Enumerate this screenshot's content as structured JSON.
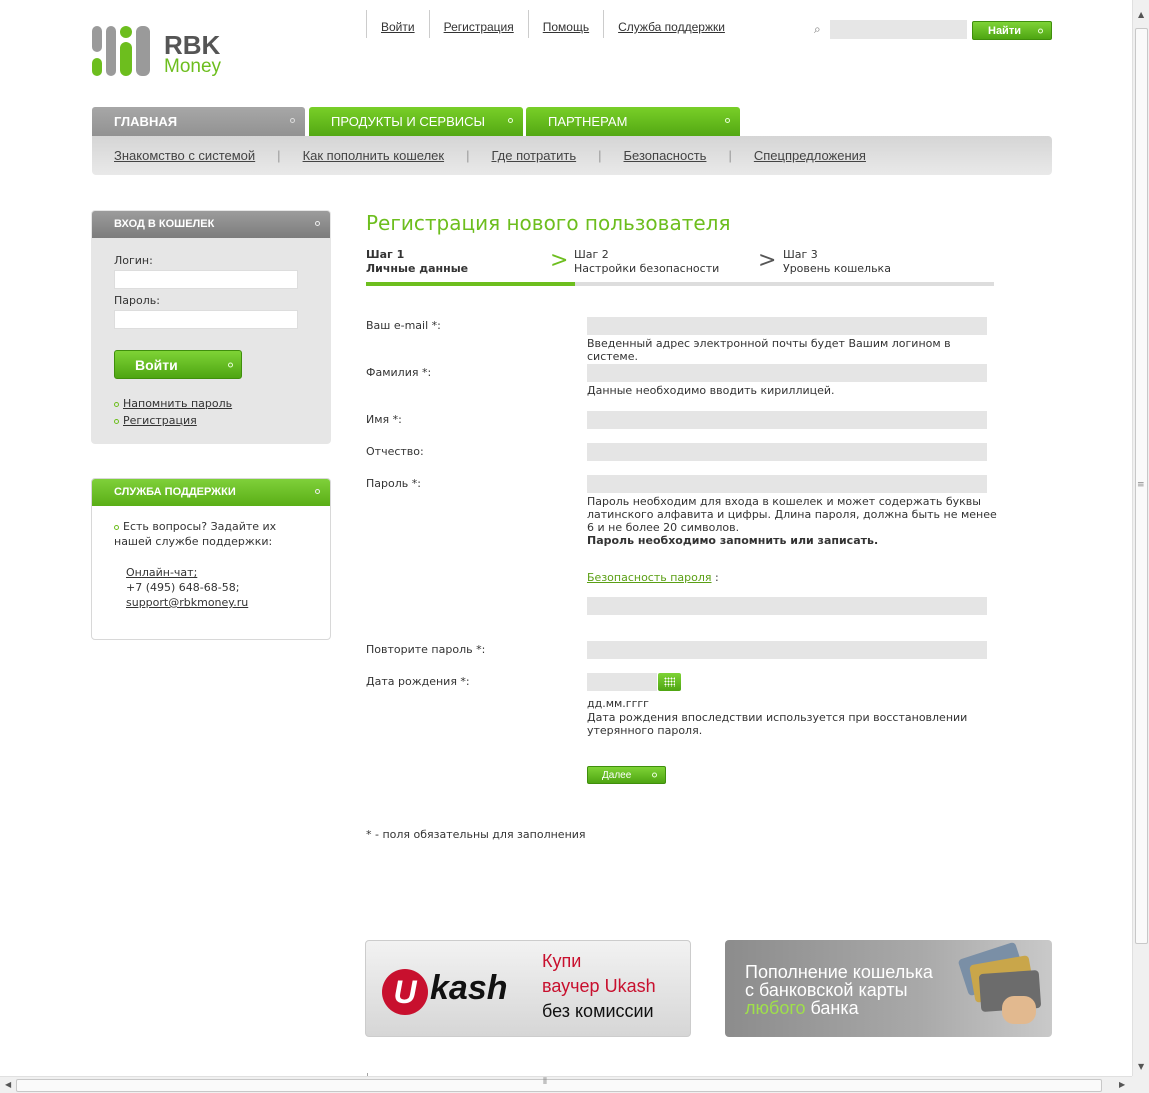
{
  "logo": {
    "line1": "RBK",
    "line2": "Money"
  },
  "top_links": [
    "Войти",
    "Регистрация",
    "Помощь",
    "Служба поддержки"
  ],
  "search": {
    "placeholder": "",
    "button": "Найти"
  },
  "main_tabs": [
    {
      "label": "ГЛАВНАЯ",
      "active": true
    },
    {
      "label": "ПРОДУКТЫ И СЕРВИСЫ",
      "active": false
    },
    {
      "label": "ПАРТНЕРАМ",
      "active": false
    }
  ],
  "sub_nav": [
    "Знакомство с системой",
    "Как пополнить кошелек",
    "Где потратить",
    "Безопасность",
    "Спецпредложения"
  ],
  "login_box": {
    "title": "ВХОД В КОШЕЛЕК",
    "login_label": "Логин:",
    "password_label": "Пароль:",
    "submit": "Войти",
    "remind": "Напомнить пароль",
    "register": "Регистрация"
  },
  "support_box": {
    "title": "СЛУЖБА ПОДДЕРЖКИ",
    "text": "Есть вопросы? Задайте их нашей службе поддержки:",
    "chat": "Онлайн-чат;",
    "phone": "+7 (495) 648-68-58;",
    "email": "support@rbkmoney.ru"
  },
  "page_title": "Регистрация нового пользователя",
  "steps": [
    {
      "num": "Шаг 1",
      "name": "Личные данные",
      "active": true
    },
    {
      "num": "Шаг 2",
      "name": "Настройки безопасности",
      "active": false
    },
    {
      "num": "Шаг 3",
      "name": "Уровень кошелька",
      "active": false
    }
  ],
  "step_progress": 0.333,
  "form": {
    "email_label": "Ваш e-mail *:",
    "email_hint": "Введенный адрес электронной почты будет Вашим логином в системе.",
    "surname_label": "Фамилия *:",
    "surname_hint": "Данные необходимо вводить кириллицей.",
    "name_label": "Имя *:",
    "patronymic_label": "Отчество:",
    "password_label": "Пароль *:",
    "password_hint": "Пароль необходим для входа в кошелек и может содержать буквы латинского алфавита и цифры. Длина пароля, должна быть не менее 6 и не более 20 символов.",
    "password_hint_bold": "Пароль необходимо запомнить или записать.",
    "password_strength_link": "Безопасность пароля",
    "password_strength_colon": ":",
    "repeat_label": "Повторите пароль *:",
    "birth_label": "Дата рождения *:",
    "birth_format": "дд.мм.гггг",
    "birth_hint": "Дата рождения впоследствии используется при восстановлении утерянного пароля.",
    "next_button": "Далее",
    "required_note": "* - поля обязательны для заполнения"
  },
  "banners": {
    "ukash": {
      "logo_u": "U",
      "logo_word": "kash",
      "line1": "Купи",
      "line2": "ваучер Ukash",
      "line3": "без комиссии"
    },
    "card": {
      "line1": "Пополнение кошелька",
      "line2": "с банковской карты",
      "line3_green": "любого",
      "line3_rest": " банка"
    }
  },
  "colors": {
    "accent": "#6dbe1e",
    "tab_gray": "#999999",
    "input_bg": "#e5e5e5"
  }
}
